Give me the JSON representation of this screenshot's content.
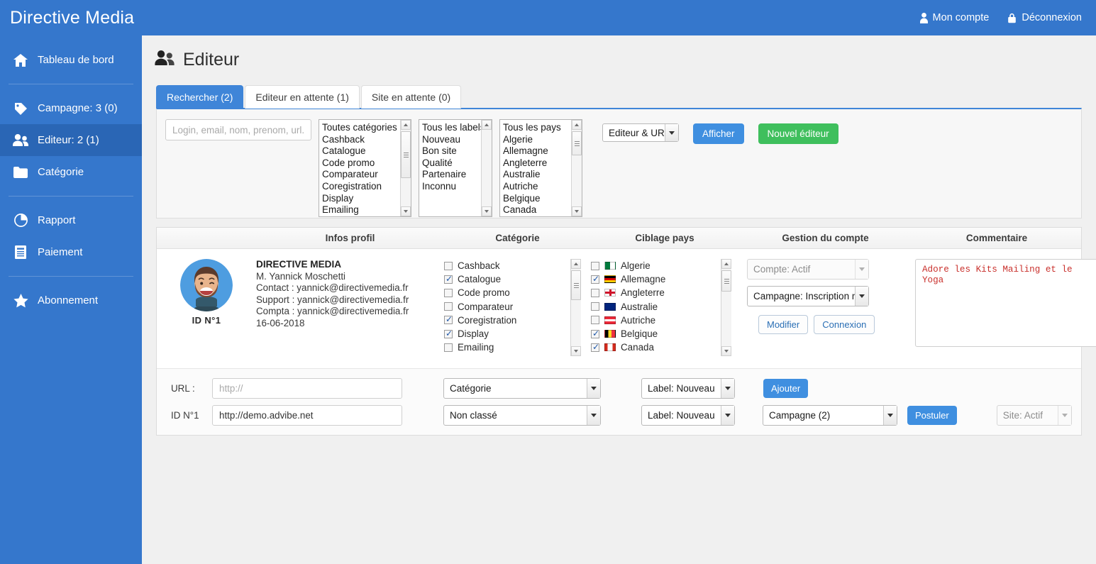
{
  "brand": "Directive Media",
  "header": {
    "account_label": "Mon compte",
    "logout_label": "Déconnexion"
  },
  "sidebar": {
    "items": [
      {
        "label": "Tableau de bord",
        "icon": "home-icon"
      },
      {
        "label": "Campagne: 3 (0)",
        "icon": "tag-icon"
      },
      {
        "label": "Editeur: 2 (1)",
        "icon": "users-icon"
      },
      {
        "label": "Catégorie",
        "icon": "folder-icon"
      },
      {
        "label": "Rapport",
        "icon": "pie-chart-icon"
      },
      {
        "label": "Paiement",
        "icon": "document-icon"
      },
      {
        "label": "Abonnement",
        "icon": "star-icon"
      }
    ]
  },
  "page": {
    "title": "Editeur",
    "icon": "users-icon"
  },
  "tabs": [
    {
      "label": "Rechercher (2)",
      "active": true
    },
    {
      "label": "Editeur en attente (1)",
      "active": false
    },
    {
      "label": "Site en attente (0)",
      "active": false
    }
  ],
  "filters": {
    "search_placeholder": "Login, email, nom, prenom, url...",
    "search_value": "",
    "categories": [
      "Toutes catégories",
      "Cashback",
      "Catalogue",
      "Code promo",
      "Comparateur",
      "Coregistration",
      "Display",
      "Emailing"
    ],
    "labels": [
      "Tous les labels",
      "Nouveau",
      "Bon site",
      "Qualité",
      "Partenaire",
      "Inconnu"
    ],
    "countries": [
      "Tous les pays",
      "Algerie",
      "Allemagne",
      "Angleterre",
      "Australie",
      "Autriche",
      "Belgique",
      "Canada"
    ],
    "scope_select": "Editeur & URL",
    "show_button": "Afficher",
    "new_editor_button": "Nouvel éditeur"
  },
  "results": {
    "columns": [
      "",
      "Infos profil",
      "Catégorie",
      "Ciblage pays",
      "Gestion du compte",
      "Commentaire"
    ],
    "row": {
      "avatar_id": "ID N°1",
      "profile": {
        "company": "DIRECTIVE MEDIA",
        "person": "M. Yannick Moschetti",
        "contact": "Contact : yannick@directivemedia.fr",
        "support": "Support : yannick@directivemedia.fr",
        "compta": "Compta : yannick@directivemedia.fr",
        "date": "16-06-2018"
      },
      "categories": [
        {
          "label": "Cashback",
          "checked": false
        },
        {
          "label": "Catalogue",
          "checked": true
        },
        {
          "label": "Code promo",
          "checked": false
        },
        {
          "label": "Comparateur",
          "checked": false
        },
        {
          "label": "Coregistration",
          "checked": true
        },
        {
          "label": "Display",
          "checked": true
        },
        {
          "label": "Emailing",
          "checked": false
        }
      ],
      "countries": [
        {
          "label": "Algerie",
          "checked": false,
          "flag": [
            "#007a3d",
            "#ffffff",
            "#d21034"
          ]
        },
        {
          "label": "Allemagne",
          "checked": true,
          "flag": [
            "#000000",
            "#dd0000",
            "#ffce00"
          ]
        },
        {
          "label": "Angleterre",
          "checked": false,
          "flag": [
            "#ffffff",
            "#cf142b",
            "#ffffff"
          ]
        },
        {
          "label": "Australie",
          "checked": false,
          "flag": [
            "#00247d",
            "#ffffff",
            "#00247d"
          ]
        },
        {
          "label": "Autriche",
          "checked": false,
          "flag": [
            "#ed2939",
            "#ffffff",
            "#ed2939"
          ]
        },
        {
          "label": "Belgique",
          "checked": true,
          "flag": [
            "#000000",
            "#fdda24",
            "#ef3340"
          ]
        },
        {
          "label": "Canada",
          "checked": true,
          "flag": [
            "#d52b1e",
            "#ffffff",
            "#d52b1e"
          ]
        }
      ],
      "account_status": "Compte: Actif",
      "campaign_status": "Campagne: Inscription m",
      "edit_button": "Modifier",
      "login_button": "Connexion",
      "comment": "Adore les Kits Mailing et le Yoga"
    }
  },
  "form": {
    "url_label": "URL :",
    "url_placeholder": "http://",
    "url_value": "",
    "id_label": "ID N°1",
    "id_url_value": "http://demo.advibe.net",
    "category_new": "Catégorie",
    "category_existing": "Non classé",
    "label_new": "Label: Nouveau",
    "label_existing": "Label: Nouveau",
    "add_button": "Ajouter",
    "campaign_select": "Campagne (2)",
    "apply_button": "Postuler",
    "site_status": "Site: Actif"
  },
  "colors": {
    "brand_blue": "#3577cc",
    "active_blue": "#2a66b5",
    "tab_blue": "#3f85d8",
    "button_blue": "#3f8fe0",
    "button_green": "#3fbf5d",
    "comment_red": "#c9302c",
    "page_bg": "#f0f0f0"
  }
}
